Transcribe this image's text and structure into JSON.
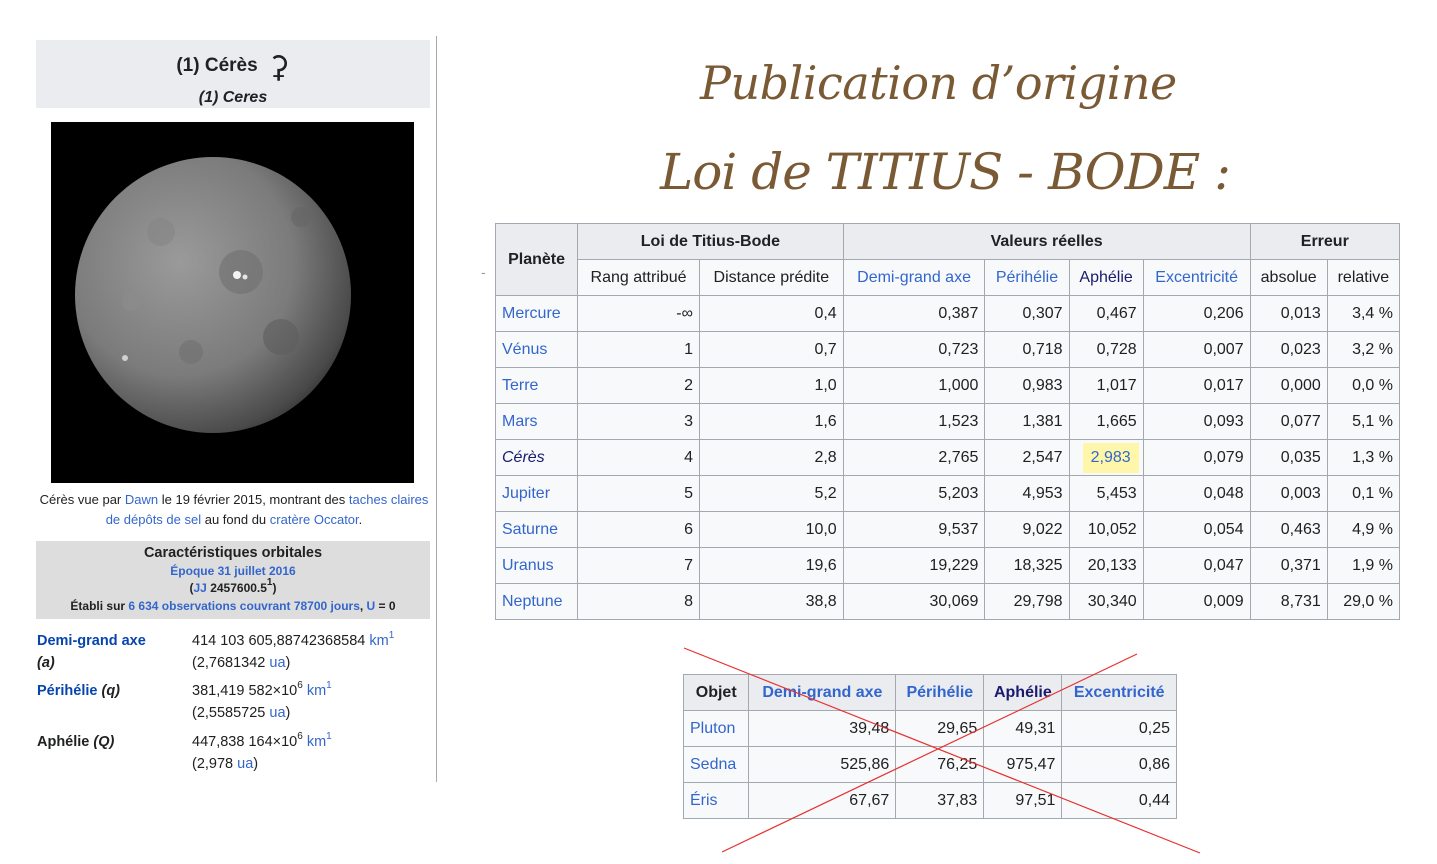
{
  "infobox": {
    "title": "(1) Cérès",
    "symbol": "⚳",
    "subtitle": "(1) Ceres",
    "caption": {
      "p1": "Cérès vue par ",
      "link1": "Dawn",
      "p2": " le 19 février 2015, montrant des ",
      "link2": "taches claires de dépôts de sel",
      "p3": " au fond du ",
      "link3": "cratère Occator",
      "p4": "."
    },
    "orbital": {
      "title": "Caractéristiques orbitales",
      "epoch": "Époque 31 juillet 2016",
      "jj_open": "(",
      "jj_link": "JJ",
      "jj_value": " 2457600.5",
      "jj_sup": "1",
      "jj_close": ")",
      "basis_pre": "Établi sur ",
      "basis_link": "6 634 observations couvrant 78700 jours",
      "basis_mid": ", ",
      "basis_u": "U",
      "basis_post": " = 0"
    },
    "rows": [
      {
        "key1": "Demi-grand axe",
        "key2": "(a)",
        "value": "414 103 605,88742368584 ",
        "unit": "km",
        "sup": "1",
        "sub_value": "(2,7681342 ",
        "sub_unit": "ua",
        "sub_close": ")"
      },
      {
        "key1": "Périhélie",
        "key2": "(q)",
        "value": "381,419 582×10",
        "exp": "6",
        "unit": "km",
        "sup": "1",
        "sub_value": "(2,5585725 ",
        "sub_unit": "ua",
        "sub_close": ")"
      },
      {
        "key1": "Aphélie",
        "key2": "(Q)",
        "value": "447,838 164×10",
        "exp": "6",
        "unit": "km",
        "sup": "1",
        "sub_value": "(2,978 ",
        "sub_unit": "ua",
        "sub_close": ")"
      }
    ]
  },
  "headings": {
    "line1": "Publication d’origine",
    "line2": "Loi de TITIUS - BODE  :"
  },
  "main_table": {
    "header_planet": "Planète",
    "group_tb": "Loi de Titius-Bode",
    "group_real": "Valeurs réelles",
    "group_err": "Erreur",
    "cols": [
      "Rang attribué",
      "Distance prédite",
      "Demi-grand axe",
      "Périhélie",
      "Aphélie",
      "Excentricité",
      "absolue",
      "relative"
    ],
    "rows": [
      [
        "Mercure",
        "-∞",
        "0,4",
        "0,387",
        "0,307",
        "0,467",
        "0,206",
        "0,013",
        "3,4 %"
      ],
      [
        "Vénus",
        "1",
        "0,7",
        "0,723",
        "0,718",
        "0,728",
        "0,007",
        "0,023",
        "3,2 %"
      ],
      [
        "Terre",
        "2",
        "1,0",
        "1,000",
        "0,983",
        "1,017",
        "0,017",
        "0,000",
        "0,0 %"
      ],
      [
        "Mars",
        "3",
        "1,6",
        "1,523",
        "1,381",
        "1,665",
        "0,093",
        "0,077",
        "5,1 %"
      ],
      [
        "Cérès",
        "4",
        "2,8",
        "2,765",
        "2,547",
        "2,983",
        "0,079",
        "0,035",
        "1,3 %"
      ],
      [
        "Jupiter",
        "5",
        "5,2",
        "5,203",
        "4,953",
        "5,453",
        "0,048",
        "0,003",
        "0,1 %"
      ],
      [
        "Saturne",
        "6",
        "10,0",
        "9,537",
        "9,022",
        "10,052",
        "0,054",
        "0,463",
        "4,9 %"
      ],
      [
        "Uranus",
        "7",
        "19,6",
        "19,229",
        "18,325",
        "20,133",
        "0,047",
        "0,371",
        "1,9 %"
      ],
      [
        "Neptune",
        "8",
        "38,8",
        "30,069",
        "29,798",
        "30,340",
        "0,009",
        "8,731",
        "29,0 %"
      ]
    ],
    "highlight_color": "#fef6a8"
  },
  "small_table": {
    "cols": [
      "Objet",
      "Demi-grand axe",
      "Périhélie",
      "Aphélie",
      "Excentricité"
    ],
    "rows": [
      [
        "Pluton",
        "39,48",
        "29,65",
        "49,31",
        "0,25"
      ],
      [
        "Sedna",
        "525,86",
        "76,25",
        "975,47",
        "0,86"
      ],
      [
        "Éris",
        "67,67",
        "37,83",
        "97,51",
        "0,44"
      ]
    ],
    "cross_color": "#e83030"
  },
  "side_mark": "-"
}
